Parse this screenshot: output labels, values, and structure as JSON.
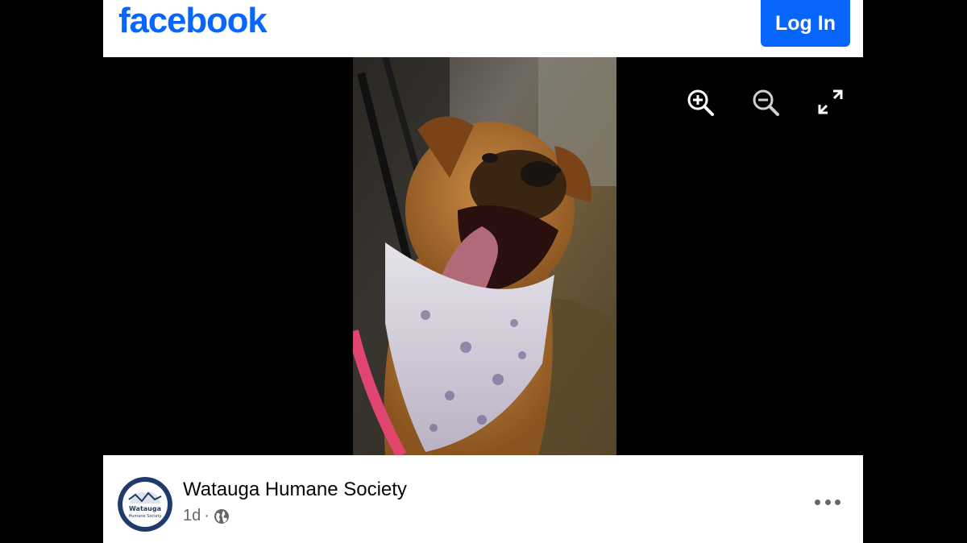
{
  "header": {
    "logo_text": "facebook",
    "login_label": "Log In",
    "brand_color": "#0866ff"
  },
  "viewer": {
    "tools": [
      {
        "name": "zoom-in-icon"
      },
      {
        "name": "zoom-out-icon"
      },
      {
        "name": "fullscreen-icon"
      }
    ]
  },
  "post": {
    "page_name": "Watauga Humane Society",
    "time_ago": "1d",
    "separator": "·",
    "audience_icon": "globe-icon",
    "avatar_text_line1": "Watauga",
    "avatar_text_line2": "Humane Society",
    "more_icon": "more-dots-icon"
  }
}
